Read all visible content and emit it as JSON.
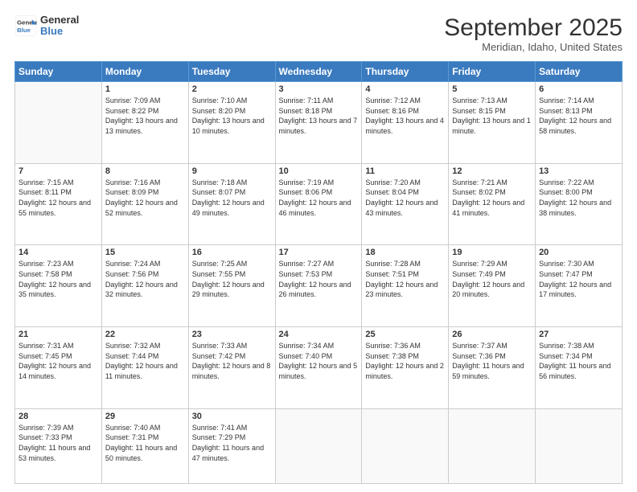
{
  "logo": {
    "line1": "General",
    "line2": "Blue"
  },
  "title": "September 2025",
  "subtitle": "Meridian, Idaho, United States",
  "days_header": [
    "Sunday",
    "Monday",
    "Tuesday",
    "Wednesday",
    "Thursday",
    "Friday",
    "Saturday"
  ],
  "weeks": [
    [
      {
        "day": "",
        "sunrise": "",
        "sunset": "",
        "daylight": ""
      },
      {
        "day": "1",
        "sunrise": "Sunrise: 7:09 AM",
        "sunset": "Sunset: 8:22 PM",
        "daylight": "Daylight: 13 hours and 13 minutes."
      },
      {
        "day": "2",
        "sunrise": "Sunrise: 7:10 AM",
        "sunset": "Sunset: 8:20 PM",
        "daylight": "Daylight: 13 hours and 10 minutes."
      },
      {
        "day": "3",
        "sunrise": "Sunrise: 7:11 AM",
        "sunset": "Sunset: 8:18 PM",
        "daylight": "Daylight: 13 hours and 7 minutes."
      },
      {
        "day": "4",
        "sunrise": "Sunrise: 7:12 AM",
        "sunset": "Sunset: 8:16 PM",
        "daylight": "Daylight: 13 hours and 4 minutes."
      },
      {
        "day": "5",
        "sunrise": "Sunrise: 7:13 AM",
        "sunset": "Sunset: 8:15 PM",
        "daylight": "Daylight: 13 hours and 1 minute."
      },
      {
        "day": "6",
        "sunrise": "Sunrise: 7:14 AM",
        "sunset": "Sunset: 8:13 PM",
        "daylight": "Daylight: 12 hours and 58 minutes."
      }
    ],
    [
      {
        "day": "7",
        "sunrise": "Sunrise: 7:15 AM",
        "sunset": "Sunset: 8:11 PM",
        "daylight": "Daylight: 12 hours and 55 minutes."
      },
      {
        "day": "8",
        "sunrise": "Sunrise: 7:16 AM",
        "sunset": "Sunset: 8:09 PM",
        "daylight": "Daylight: 12 hours and 52 minutes."
      },
      {
        "day": "9",
        "sunrise": "Sunrise: 7:18 AM",
        "sunset": "Sunset: 8:07 PM",
        "daylight": "Daylight: 12 hours and 49 minutes."
      },
      {
        "day": "10",
        "sunrise": "Sunrise: 7:19 AM",
        "sunset": "Sunset: 8:06 PM",
        "daylight": "Daylight: 12 hours and 46 minutes."
      },
      {
        "day": "11",
        "sunrise": "Sunrise: 7:20 AM",
        "sunset": "Sunset: 8:04 PM",
        "daylight": "Daylight: 12 hours and 43 minutes."
      },
      {
        "day": "12",
        "sunrise": "Sunrise: 7:21 AM",
        "sunset": "Sunset: 8:02 PM",
        "daylight": "Daylight: 12 hours and 41 minutes."
      },
      {
        "day": "13",
        "sunrise": "Sunrise: 7:22 AM",
        "sunset": "Sunset: 8:00 PM",
        "daylight": "Daylight: 12 hours and 38 minutes."
      }
    ],
    [
      {
        "day": "14",
        "sunrise": "Sunrise: 7:23 AM",
        "sunset": "Sunset: 7:58 PM",
        "daylight": "Daylight: 12 hours and 35 minutes."
      },
      {
        "day": "15",
        "sunrise": "Sunrise: 7:24 AM",
        "sunset": "Sunset: 7:56 PM",
        "daylight": "Daylight: 12 hours and 32 minutes."
      },
      {
        "day": "16",
        "sunrise": "Sunrise: 7:25 AM",
        "sunset": "Sunset: 7:55 PM",
        "daylight": "Daylight: 12 hours and 29 minutes."
      },
      {
        "day": "17",
        "sunrise": "Sunrise: 7:27 AM",
        "sunset": "Sunset: 7:53 PM",
        "daylight": "Daylight: 12 hours and 26 minutes."
      },
      {
        "day": "18",
        "sunrise": "Sunrise: 7:28 AM",
        "sunset": "Sunset: 7:51 PM",
        "daylight": "Daylight: 12 hours and 23 minutes."
      },
      {
        "day": "19",
        "sunrise": "Sunrise: 7:29 AM",
        "sunset": "Sunset: 7:49 PM",
        "daylight": "Daylight: 12 hours and 20 minutes."
      },
      {
        "day": "20",
        "sunrise": "Sunrise: 7:30 AM",
        "sunset": "Sunset: 7:47 PM",
        "daylight": "Daylight: 12 hours and 17 minutes."
      }
    ],
    [
      {
        "day": "21",
        "sunrise": "Sunrise: 7:31 AM",
        "sunset": "Sunset: 7:45 PM",
        "daylight": "Daylight: 12 hours and 14 minutes."
      },
      {
        "day": "22",
        "sunrise": "Sunrise: 7:32 AM",
        "sunset": "Sunset: 7:44 PM",
        "daylight": "Daylight: 12 hours and 11 minutes."
      },
      {
        "day": "23",
        "sunrise": "Sunrise: 7:33 AM",
        "sunset": "Sunset: 7:42 PM",
        "daylight": "Daylight: 12 hours and 8 minutes."
      },
      {
        "day": "24",
        "sunrise": "Sunrise: 7:34 AM",
        "sunset": "Sunset: 7:40 PM",
        "daylight": "Daylight: 12 hours and 5 minutes."
      },
      {
        "day": "25",
        "sunrise": "Sunrise: 7:36 AM",
        "sunset": "Sunset: 7:38 PM",
        "daylight": "Daylight: 12 hours and 2 minutes."
      },
      {
        "day": "26",
        "sunrise": "Sunrise: 7:37 AM",
        "sunset": "Sunset: 7:36 PM",
        "daylight": "Daylight: 11 hours and 59 minutes."
      },
      {
        "day": "27",
        "sunrise": "Sunrise: 7:38 AM",
        "sunset": "Sunset: 7:34 PM",
        "daylight": "Daylight: 11 hours and 56 minutes."
      }
    ],
    [
      {
        "day": "28",
        "sunrise": "Sunrise: 7:39 AM",
        "sunset": "Sunset: 7:33 PM",
        "daylight": "Daylight: 11 hours and 53 minutes."
      },
      {
        "day": "29",
        "sunrise": "Sunrise: 7:40 AM",
        "sunset": "Sunset: 7:31 PM",
        "daylight": "Daylight: 11 hours and 50 minutes."
      },
      {
        "day": "30",
        "sunrise": "Sunrise: 7:41 AM",
        "sunset": "Sunset: 7:29 PM",
        "daylight": "Daylight: 11 hours and 47 minutes."
      },
      {
        "day": "",
        "sunrise": "",
        "sunset": "",
        "daylight": ""
      },
      {
        "day": "",
        "sunrise": "",
        "sunset": "",
        "daylight": ""
      },
      {
        "day": "",
        "sunrise": "",
        "sunset": "",
        "daylight": ""
      },
      {
        "day": "",
        "sunrise": "",
        "sunset": "",
        "daylight": ""
      }
    ]
  ]
}
